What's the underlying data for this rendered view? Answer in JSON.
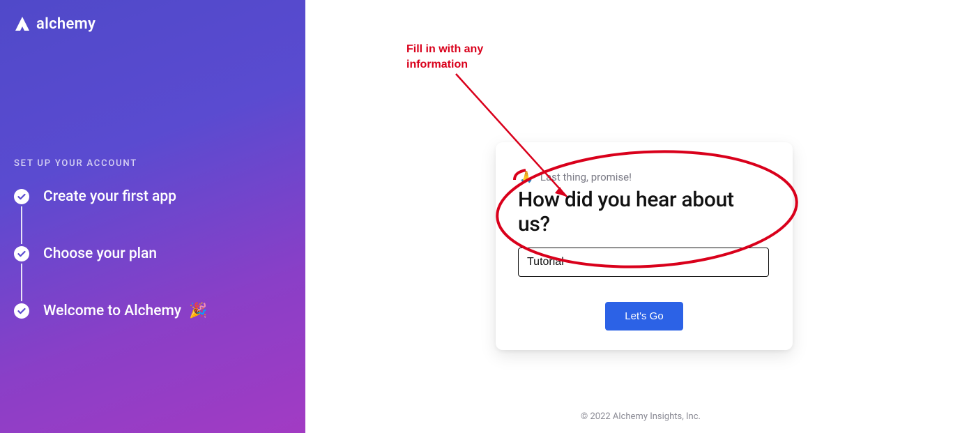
{
  "brand": {
    "name": "alchemy"
  },
  "sidebar": {
    "heading": "SET UP YOUR ACCOUNT",
    "steps": [
      {
        "label": "Create your first app"
      },
      {
        "label": "Choose your plan"
      },
      {
        "label": "Welcome to Alchemy",
        "emoji": "🎉"
      }
    ]
  },
  "card": {
    "eyebrow_emoji": "🙏",
    "eyebrow_text": "Last thing, promise!",
    "title": "How did you hear about us?",
    "input_value": "Tutorial",
    "button_label": "Let's Go"
  },
  "annotation": {
    "line1": "Fill in with any",
    "line2": "information"
  },
  "footer": {
    "text": "© 2022 Alchemy Insights, Inc."
  }
}
